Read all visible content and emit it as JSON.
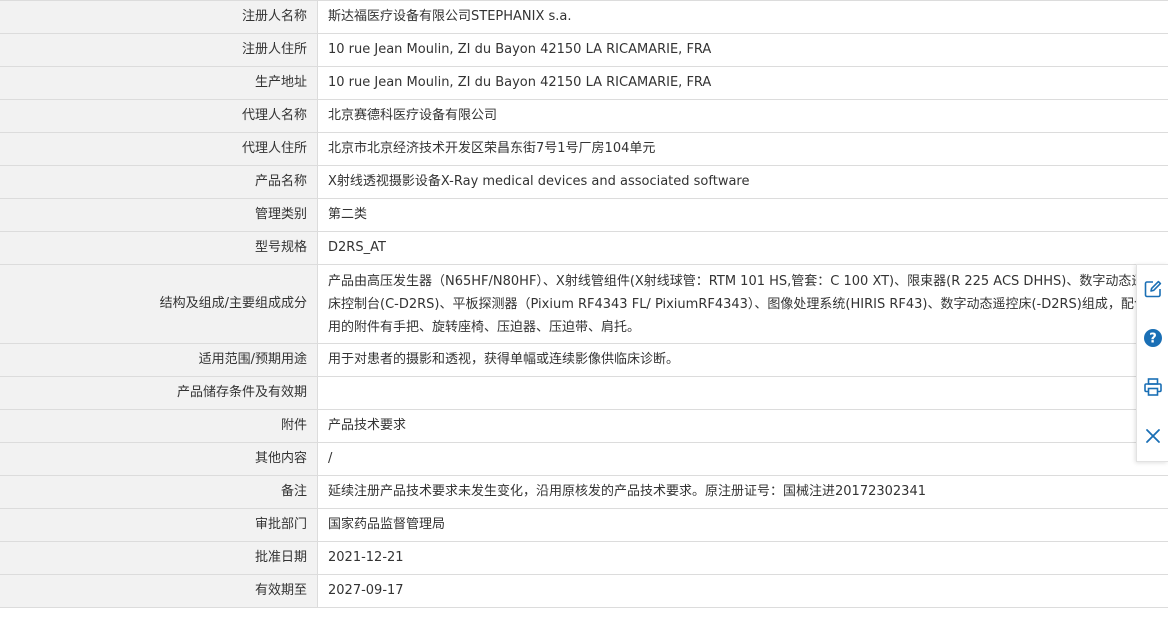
{
  "rows": [
    {
      "label": "注册人名称",
      "value": "斯达福医疗设备有限公司STEPHANIX s.a."
    },
    {
      "label": "注册人住所",
      "value": "10 rue Jean Moulin, ZI du Bayon 42150 LA RICAMARIE, FRA"
    },
    {
      "label": "生产地址",
      "value": "10 rue Jean Moulin, ZI du Bayon 42150 LA RICAMARIE, FRA"
    },
    {
      "label": "代理人名称",
      "value": "北京赛德科医疗设备有限公司"
    },
    {
      "label": "代理人住所",
      "value": "北京市北京经济技术开发区荣昌东街7号1号厂房104单元"
    },
    {
      "label": "产品名称",
      "value": "X射线透视摄影设备X-Ray medical devices and associated software"
    },
    {
      "label": "管理类别",
      "value": "第二类"
    },
    {
      "label": "型号规格",
      "value": "D2RS_AT"
    },
    {
      "label": "结构及组成/主要组成成分",
      "value": "产品由高压发生器（N65HF/N80HF）、X射线管组件(X射线球管：RTM 101 HS,管套：C 100 XT)、限束器(R 225 ACS DHHS)、数字动态遥控床控制台(C-D2RS)、平板探测器（Pixium RF4343 FL/ PixiumRF4343）、图像处理系统(HIRIS RF43)、数字动态遥控床(-D2RS)组成，配合使用的附件有手把、旋转座椅、压迫器、压迫带、肩托。"
    },
    {
      "label": "适用范围/预期用途",
      "value": "用于对患者的摄影和透视，获得单幅或连续影像供临床诊断。"
    },
    {
      "label": "产品储存条件及有效期",
      "value": ""
    },
    {
      "label": "附件",
      "value": "产品技术要求"
    },
    {
      "label": "其他内容",
      "value": "/"
    },
    {
      "label": "备注",
      "value": "延续注册产品技术要求未发生变化，沿用原核发的产品技术要求。原注册证号：国械注进20172302341"
    },
    {
      "label": "审批部门",
      "value": "国家药品监督管理局"
    },
    {
      "label": "批准日期",
      "value": "2021-12-21"
    },
    {
      "label": "有效期至",
      "value": "2027-09-17"
    }
  ],
  "toolbar": {
    "icons": [
      "edit-icon",
      "help-icon",
      "print-icon",
      "close-icon"
    ],
    "accent_color": "#1a6fb5"
  }
}
